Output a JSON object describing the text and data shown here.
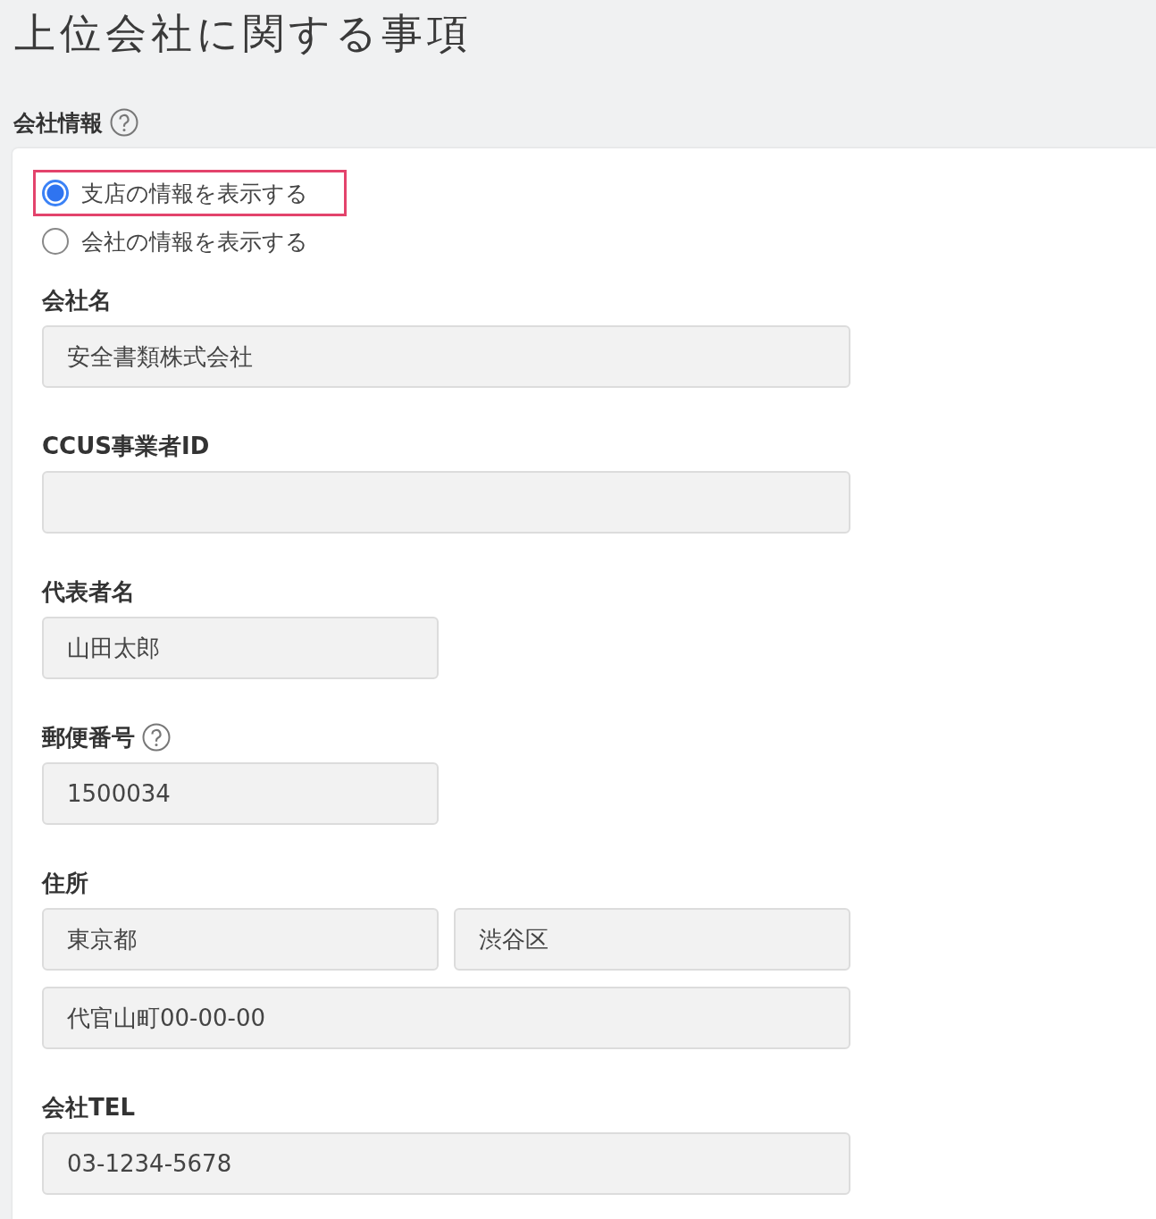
{
  "page_title": "上位会社に関する事項",
  "section": {
    "label": "会社情報",
    "help": true
  },
  "options": [
    {
      "label": "支店の情報を表示する",
      "selected": true,
      "highlighted": true
    },
    {
      "label": "会社の情報を表示する",
      "selected": false,
      "highlighted": false
    }
  ],
  "fields": [
    {
      "label": "会社名",
      "help": false,
      "inputs": [
        {
          "value": "安全書類株式会社",
          "kind": "wide"
        }
      ]
    },
    {
      "label": "CCUS事業者ID",
      "help": false,
      "inputs": [
        {
          "kind": "wide"
        }
      ]
    },
    {
      "label": "代表者名",
      "help": false,
      "inputs": [
        {
          "value": "山田太郎",
          "kind": "narrow"
        }
      ]
    },
    {
      "label": "郵便番号",
      "help": true,
      "inputs": [
        {
          "value": "1500034",
          "kind": "narrow"
        }
      ]
    },
    {
      "label": "住所",
      "help": false,
      "inputs": [
        {
          "value": "東京都",
          "kind": "narrow"
        },
        {
          "value": "渋谷区",
          "kind": "narrow"
        },
        {
          "value": "代官山町00-00-00",
          "kind": "wide"
        }
      ]
    },
    {
      "label": "会社TEL",
      "help": false,
      "inputs": [
        {
          "value": "03-1234-5678",
          "kind": "wide"
        }
      ]
    }
  ]
}
